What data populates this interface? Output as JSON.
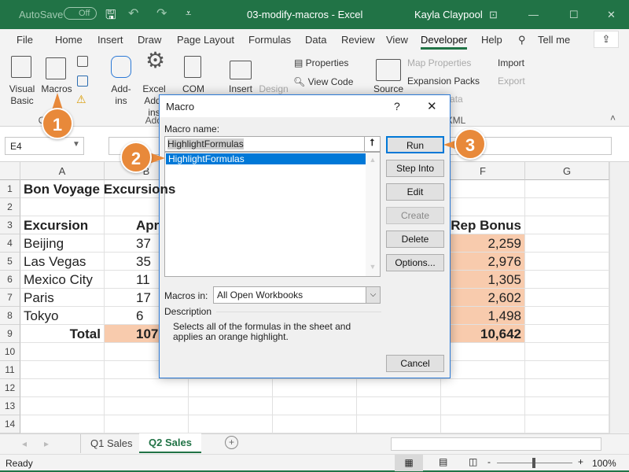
{
  "titlebar": {
    "autosave": "AutoSave",
    "autosave_state": "Off",
    "title": "03-modify-macros  -  Excel",
    "user": "Kayla Claypool"
  },
  "tabs": [
    "File",
    "Home",
    "Insert",
    "Draw",
    "Page Layout",
    "Formulas",
    "Data",
    "Review",
    "View",
    "Developer",
    "Help",
    "Tell me"
  ],
  "active_tab": "Developer",
  "ribbon": {
    "visual_basic": "Visual Basic",
    "macros": "Macros",
    "group_code": "Code",
    "addins": "Add-ins",
    "excel_addins": "Excel Add-ins",
    "com": "COM",
    "group_addins": "Add-ins",
    "insert": "Insert",
    "design": "Design",
    "properties": "Properties",
    "view_code": "View Code",
    "source": "Source",
    "map_properties": "Map Properties",
    "expansion_packs": "Expansion Packs",
    "refresh_data": "Refresh Data",
    "import": "Import",
    "export": "Export",
    "group_xml": "XML"
  },
  "namebox": "E4",
  "columns": [
    "A",
    "B",
    "C",
    "D",
    "E",
    "F",
    "G"
  ],
  "rows": [
    "1",
    "2",
    "3",
    "4",
    "5",
    "6",
    "7",
    "8",
    "9",
    "10",
    "11",
    "12",
    "13",
    "14"
  ],
  "cells": {
    "A1": "Bon Voyage Excursions",
    "A3": "Excursion",
    "B3": "April",
    "F3": "Rep Bonus",
    "A4": "Beijing",
    "A5": "Las Vegas",
    "A6": "Mexico City",
    "A7": "Paris",
    "A8": "Tokyo",
    "A9": "Total",
    "B4": "37",
    "B5": "35",
    "B6": "11",
    "B7": "17",
    "B8": "6",
    "B9": "107",
    "F4": "2,259",
    "F5": "2,976",
    "F6": "1,305",
    "F7": "2,602",
    "F8": "1,498",
    "F9": "10,642"
  },
  "sheets": [
    "Q1 Sales",
    "Q2 Sales"
  ],
  "active_sheet": "Q2 Sales",
  "status": {
    "ready": "Ready",
    "zoom": "100%"
  },
  "dialog": {
    "title": "Macro",
    "help": "?",
    "macro_name_label": "Macro name:",
    "macro_name_value": "HighlightFormulas",
    "macro_list": [
      "HighlightFormulas"
    ],
    "macros_in_label": "Macros in:",
    "macros_in_value": "All Open Workbooks",
    "description_label": "Description",
    "description": "Selects all of the formulas in the sheet and applies an orange highlight.",
    "buttons": {
      "run": "Run",
      "step_into": "Step Into",
      "edit": "Edit",
      "create": "Create",
      "delete": "Delete",
      "options": "Options...",
      "cancel": "Cancel"
    }
  },
  "callouts": [
    "1",
    "2",
    "3"
  ],
  "colors": {
    "excel_green": "#217346",
    "callout": "#e8893a",
    "highlight": "#f8cbad",
    "selection": "#0078d7"
  }
}
